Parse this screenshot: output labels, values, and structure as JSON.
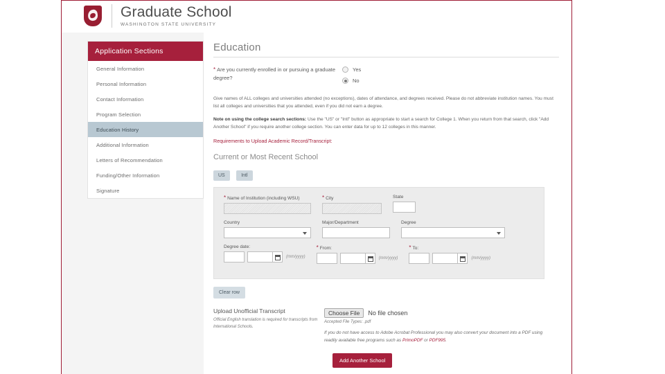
{
  "header": {
    "logo_icon": "wsu-cougar-shield-icon",
    "title": "Graduate School",
    "subtitle": "Washington State University"
  },
  "sidebar": {
    "heading": "Application Sections",
    "items": [
      {
        "label": "General Information",
        "active": false
      },
      {
        "label": "Personal Information",
        "active": false
      },
      {
        "label": "Contact Information",
        "active": false
      },
      {
        "label": "Program Selection",
        "active": false
      },
      {
        "label": "Education History",
        "active": true
      },
      {
        "label": "Additional Information",
        "active": false
      },
      {
        "label": "Letters of Recommendation",
        "active": false
      },
      {
        "label": "Funding/Other Information",
        "active": false
      },
      {
        "label": "Signature",
        "active": false
      }
    ]
  },
  "main": {
    "section_title": "Education",
    "question": {
      "required_marker": "*",
      "label": "Are you currently enrolled in or pursuing a graduate degree?",
      "options": [
        {
          "label": "Yes",
          "selected": false
        },
        {
          "label": "No",
          "selected": true
        }
      ]
    },
    "paragraph_1": "Give names of ALL colleges and universities attended (no exceptions), dates of attendance, and degrees received. Please do not abbreviate institution names. You must list all colleges and universities that you attended, even if you did not earn a degree.",
    "paragraph_2_lead": "Note on using the college search sections:",
    "paragraph_2_rest": " Use the \"US\" or \"Intl\" button as appropriate to start a search for College 1. When you return from that search, click \"Add Another School\" if you require another college section. You can enter data for up to 12 colleges in this manner.",
    "requirements_heading": "Requirements to Upload Academic Record/Transcript:",
    "school_section_title": "Current or Most Recent School",
    "toggle_buttons": [
      {
        "label": "US"
      },
      {
        "label": "Intl"
      }
    ],
    "form": {
      "row1": {
        "institution": {
          "label": "Name of Institution (including WSU)",
          "required": true,
          "value": ""
        },
        "city": {
          "label": "City",
          "required": true,
          "value": ""
        },
        "state": {
          "label": "State",
          "required": false,
          "value": ""
        }
      },
      "row2": {
        "country": {
          "label": "Country",
          "value": ""
        },
        "major": {
          "label": "Major/Department",
          "value": ""
        },
        "degree": {
          "label": "Degree",
          "value": ""
        }
      },
      "row3": {
        "degree_date": {
          "label": "Degree date:",
          "required": false,
          "month": "",
          "year": "",
          "hint": "(mm/yyyy)",
          "calendar_icon": "calendar-icon"
        },
        "from": {
          "label": "From:",
          "required": true,
          "month": "",
          "year": "",
          "hint": "(mm/yyyy)",
          "calendar_icon": "calendar-icon"
        },
        "to": {
          "label": "To:",
          "required": true,
          "month": "",
          "year": "",
          "hint": "(mm/yyyy)",
          "calendar_icon": "calendar-icon"
        }
      }
    },
    "clear_row_label": "Clear row",
    "upload": {
      "title": "Upload Unofficial Transcript",
      "note": "Official English translation is required for transcripts from International Schools.",
      "choose_file_label": "Choose File",
      "file_status": "No file chosen",
      "accepted_types": "Accepted File Types: .pdf",
      "pdf_note_prefix": "If you do not have access to Adobe Acrobat Professional you may also convert your document into a PDF using readily available free programs such as ",
      "pdf_link_1": "PrimoPDF",
      "pdf_note_middle": " or ",
      "pdf_link_2": "PDF995",
      "pdf_note_suffix": "."
    },
    "add_school_label": "Add Another School"
  },
  "colors": {
    "crimson": "#a6203c",
    "frame_border": "#9e1b34",
    "active_item": "#b8c8d2",
    "panel_bg": "#ececec"
  }
}
